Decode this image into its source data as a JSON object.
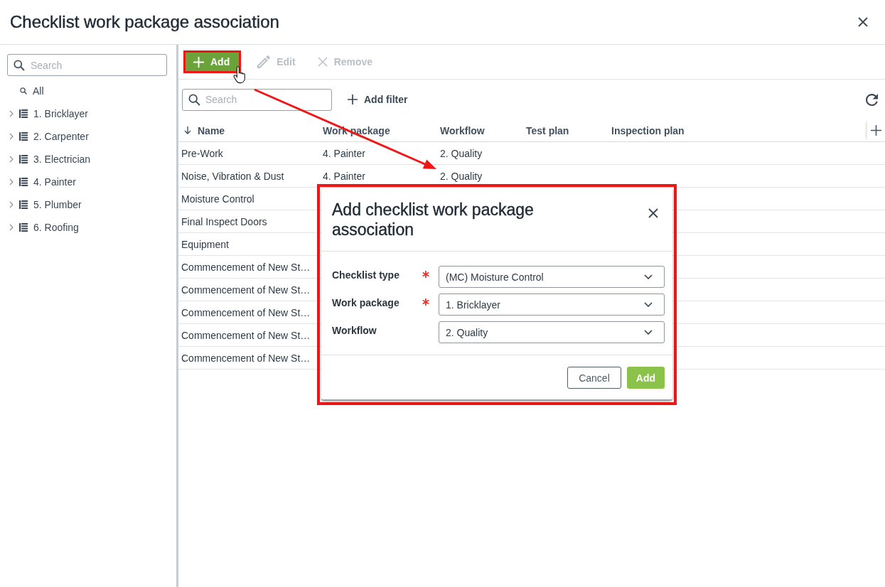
{
  "dialog": {
    "title": "Checklist work package association"
  },
  "sidebar": {
    "search": {
      "placeholder": "Search"
    },
    "all_item": {
      "label": "All",
      "selected": false
    },
    "tree": [
      {
        "label": "1. Bricklayer",
        "expanded": false,
        "selected": false
      },
      {
        "label": "2. Carpenter",
        "expanded": false,
        "selected": false
      },
      {
        "label": "3. Electrician",
        "expanded": false,
        "selected": false
      },
      {
        "label": "4. Painter",
        "expanded": false,
        "selected": false
      },
      {
        "label": "5. Plumber",
        "expanded": false,
        "selected": false
      },
      {
        "label": "6. Roofing",
        "expanded": false,
        "selected": false
      }
    ]
  },
  "toolbar": [
    {
      "kind": "add",
      "label": "Add",
      "disabled": false,
      "highlighted": true,
      "hovered": true
    },
    {
      "kind": "edit",
      "label": "Edit",
      "disabled": true,
      "highlighted": false,
      "hovered": false
    },
    {
      "kind": "remove",
      "label": "Remove",
      "disabled": true,
      "highlighted": false,
      "hovered": false
    }
  ],
  "filter_bar": {
    "search": {
      "placeholder": "Search"
    },
    "add_filter": {
      "label": "Add filter"
    }
  },
  "table": {
    "columns": [
      {
        "label": "Name",
        "sorted": true
      },
      {
        "label": "Work package",
        "sorted": false
      },
      {
        "label": "Workflow",
        "sorted": false
      },
      {
        "label": "Test plan",
        "sorted": false
      },
      {
        "label": "Inspection plan",
        "sorted": false
      }
    ],
    "rows": [
      {
        "cells": [
          "Pre-Work",
          "4. Painter",
          "2. Quality"
        ]
      },
      {
        "cells": [
          "Noise, Vibration & Dust",
          "4. Painter",
          "2. Quality"
        ]
      },
      {
        "cells": [
          "Moisture Control"
        ]
      },
      {
        "cells": [
          "Final Inspect Doors"
        ]
      },
      {
        "cells": [
          "Equipment"
        ]
      },
      {
        "cells": [
          "Commencement of New St…"
        ]
      },
      {
        "cells": [
          "Commencement of New St…"
        ]
      },
      {
        "cells": [
          "Commencement of New St…"
        ]
      },
      {
        "cells": [
          "Commencement of New St…"
        ]
      },
      {
        "cells": [
          "Commencement of New St…"
        ]
      }
    ]
  },
  "modal": {
    "title": "Add checklist work package association",
    "highlighted": true,
    "fields": [
      {
        "label": "Checklist type",
        "required": true,
        "value": "(MC) Moisture Control"
      },
      {
        "label": "Work package",
        "required": true,
        "value": "1. Bricklayer"
      },
      {
        "label": "Workflow",
        "required": false,
        "value": "2. Quality"
      }
    ],
    "buttons": [
      {
        "kind": "secondary",
        "label": "Cancel"
      },
      {
        "kind": "primary",
        "label": "Add"
      }
    ]
  },
  "annotation": {
    "arrow": true
  }
}
